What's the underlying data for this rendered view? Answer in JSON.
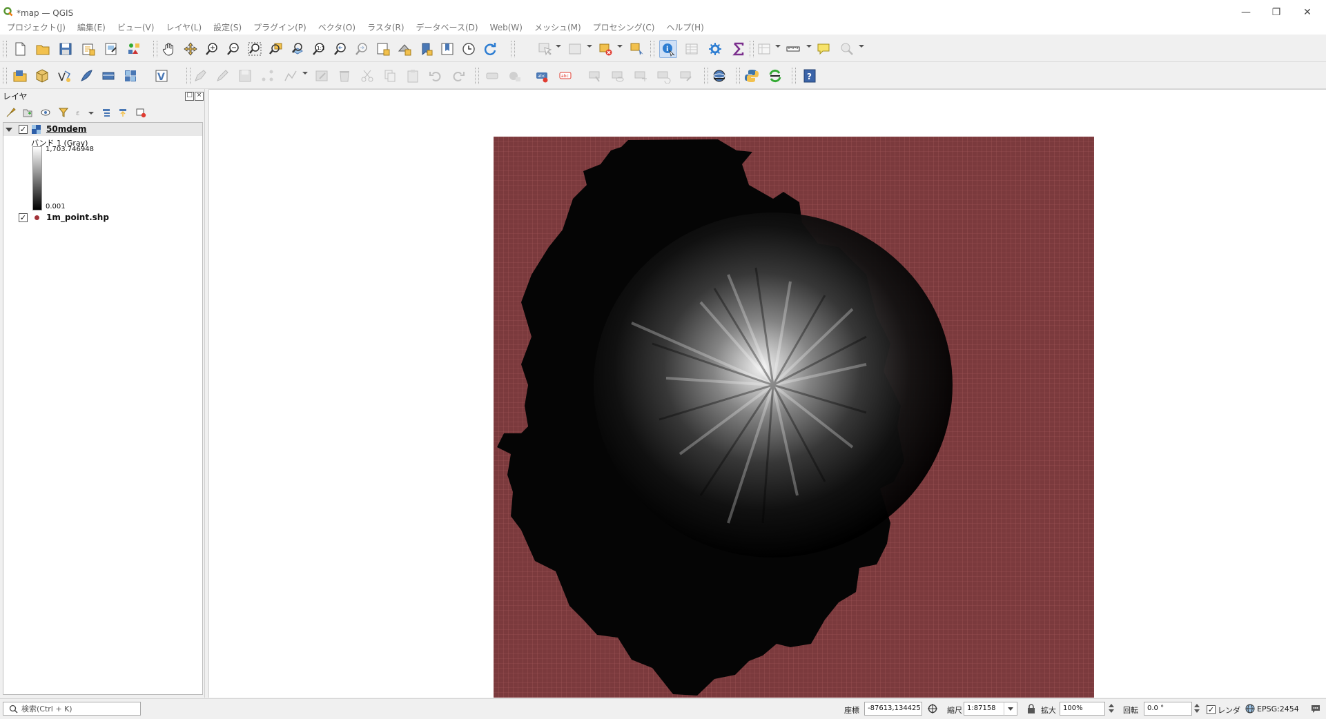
{
  "window": {
    "title": "*map — QGIS",
    "app_icon": "qgis-logo-icon",
    "controls": [
      "minimize-icon",
      "restore-icon",
      "close-icon"
    ]
  },
  "menubar": {
    "items": [
      {
        "label": "プロジェクト(J)"
      },
      {
        "label": "編集(E)"
      },
      {
        "label": "ビュー(V)"
      },
      {
        "label": "レイヤ(L)"
      },
      {
        "label": "設定(S)"
      },
      {
        "label": "プラグイン(P)"
      },
      {
        "label": "ベクタ(O)"
      },
      {
        "label": "ラスタ(R)"
      },
      {
        "label": "データベース(D)"
      },
      {
        "label": "Web(W)"
      },
      {
        "label": "メッシュ(M)"
      },
      {
        "label": "プロセシング(C)"
      },
      {
        "label": "ヘルプ(H)"
      }
    ]
  },
  "toolbar1": {
    "icons": [
      "new-project-icon",
      "open-project-icon",
      "save-project-icon",
      "print-layout-icon",
      "layout-manager-icon",
      "style-manager-icon",
      "pan-icon",
      "pan-to-selection-icon",
      "zoom-in-icon",
      "zoom-out-icon",
      "zoom-full-icon",
      "zoom-to-selection-icon",
      "zoom-to-layer-icon",
      "zoom-native-icon",
      "zoom-last-icon",
      "zoom-next-icon",
      "new-map-view-icon",
      "new-3d-view-icon",
      "new-bookmark-icon",
      "show-bookmarks-icon",
      "temporal-controller-icon",
      "refresh-icon",
      "identify-icon",
      "attribute-table-icon",
      "processing-toolbox-icon",
      "statistics-icon",
      "measure-icon",
      "map-tips-icon"
    ]
  },
  "toolbar2": {
    "icons": [
      "data-source-manager-icon",
      "new-geopackage-layer-icon",
      "new-shapefile-layer-icon",
      "new-spatialite-layer-icon",
      "add-virtual-layer-icon",
      "add-wms-layer-icon",
      "add-vector-layer-icon",
      "digitize-icon",
      "edit-pencil-icon",
      "save-edits-icon",
      "vertex-tool-icon",
      "add-feature-icon",
      "modify-attributes-icon",
      "delete-selected-icon",
      "cut-features-icon",
      "copy-features-icon",
      "paste-features-icon",
      "undo-icon",
      "redo-icon",
      "label-icon",
      "rule-label-icon",
      "add-label-icon",
      "label-abc-icon",
      "pin-labels-icon",
      "show-hide-labels-icon",
      "move-label-icon",
      "rotate-label-icon",
      "change-label-icon",
      "qgis-globe-icon",
      "python-icon",
      "plugin-reloader-icon",
      "help-icon"
    ]
  },
  "layers_panel": {
    "title": "レイヤ",
    "layers": [
      {
        "name": "50mdem",
        "checked": true,
        "type_icon": "raster-layer-icon",
        "band_label": "バンド 1 (Gray)",
        "max_value": "1,703.746948",
        "min_value": "0.001"
      },
      {
        "name": "1m_point.shp",
        "checked": true,
        "type_icon": "point-layer-icon",
        "symbol_color": "#a23238"
      }
    ]
  },
  "statusbar": {
    "locator_placeholder": "検索(Ctrl + K)",
    "coordinate_label": "座標",
    "coordinate_value": "-87613,134425",
    "scale_label": "縮尺",
    "scale_value": "1:87158",
    "magnifier_label": "拡大",
    "magnifier_value": "100%",
    "rotation_label": "回転",
    "rotation_value": "0.0 °",
    "render_label": "レンダ",
    "render_checked": true,
    "crs_label": "EPSG:2454"
  },
  "colors": {
    "grid_fill": "#7b3a3d",
    "grid_line": "#a85a5d",
    "raster_low": "#000000",
    "raster_high": "#ffffff",
    "active_tool": "#cfe0f6"
  }
}
